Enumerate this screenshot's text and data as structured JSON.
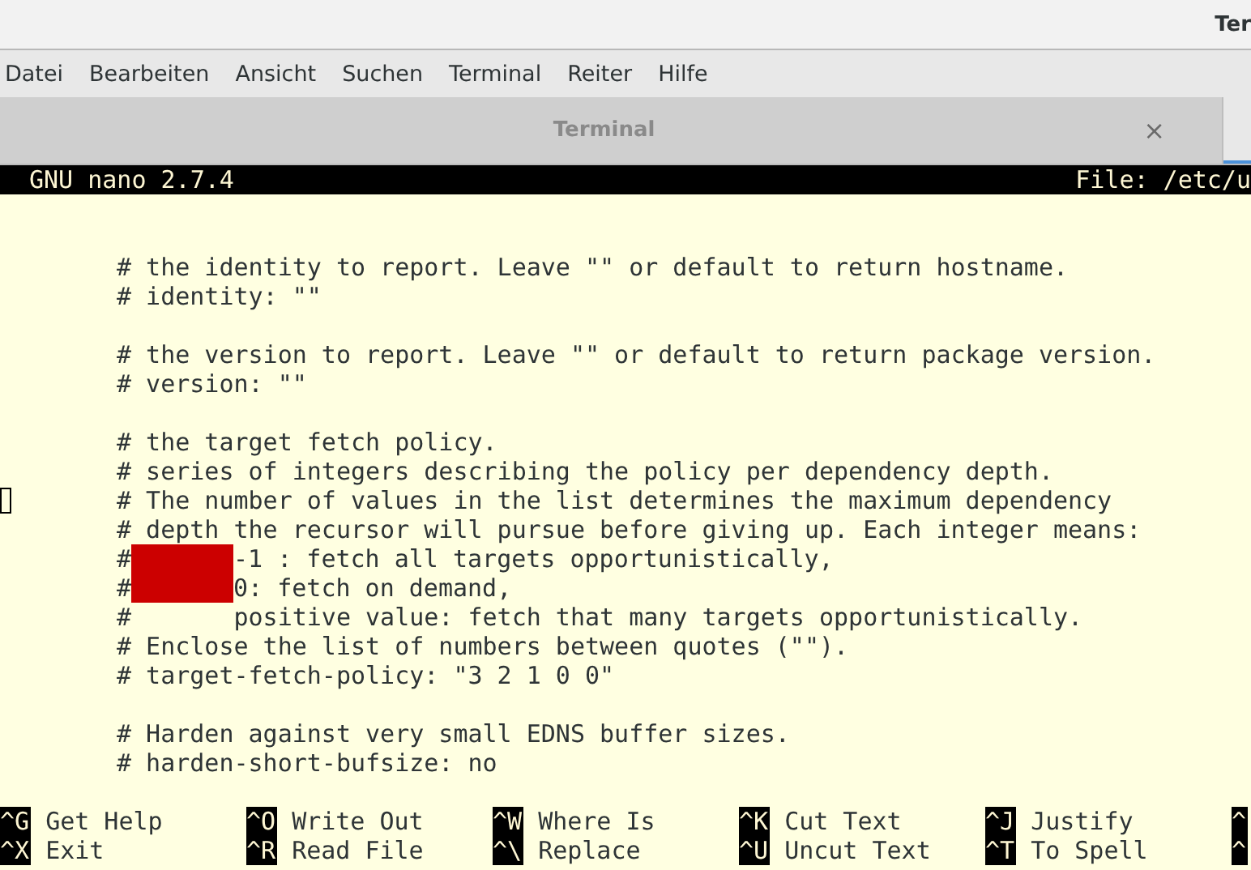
{
  "window": {
    "title": "Ter"
  },
  "menu": [
    "Datei",
    "Bearbeiten",
    "Ansicht",
    "Suchen",
    "Terminal",
    "Reiter",
    "Hilfe"
  ],
  "tabs": [
    {
      "label": "Terminal",
      "close": "×",
      "selected": false
    }
  ],
  "nano": {
    "version": "GNU nano 2.7.4",
    "file": "File: /etc/u",
    "lines": [
      {
        "kind": "blank"
      },
      {
        "kind": "blank"
      },
      {
        "kind": "text",
        "text": "# the identity to report. Leave \"\" or default to return hostname.",
        "cursor": false
      },
      {
        "kind": "text",
        "text": "# identity: \"\"",
        "cursor": false
      },
      {
        "kind": "blank"
      },
      {
        "kind": "text",
        "text": "# the version to report. Leave \"\" or default to return package version.",
        "cursor": false
      },
      {
        "kind": "text",
        "text": "# version: \"\"",
        "cursor": false
      },
      {
        "kind": "blank"
      },
      {
        "kind": "text",
        "text": "# the target fetch policy.",
        "cursor": false
      },
      {
        "kind": "text",
        "text": "# series of integers describing the policy per dependency depth.",
        "cursor": false
      },
      {
        "kind": "text",
        "text": "# The number of values in the list determines the maximum dependency",
        "cursor": true
      },
      {
        "kind": "text",
        "text": "# depth the recursor will pursue before giving up. Each integer means:",
        "cursor": false
      },
      {
        "kind": "tab",
        "prefix": "#",
        "text": "-1 : fetch all targets opportunistically,",
        "cursor": false
      },
      {
        "kind": "tab",
        "prefix": "#",
        "text": "0: fetch on demand,",
        "cursor": false
      },
      {
        "kind": "text",
        "text": "#       positive value: fetch that many targets opportunistically.",
        "cursor": false
      },
      {
        "kind": "text",
        "text": "# Enclose the list of numbers between quotes (\"\").",
        "cursor": false
      },
      {
        "kind": "text",
        "text": "# target-fetch-policy: \"3 2 1 0 0\"",
        "cursor": false
      },
      {
        "kind": "blank"
      },
      {
        "kind": "text",
        "text": "# Harden against very small EDNS buffer sizes.",
        "cursor": false
      },
      {
        "kind": "text",
        "text": "# harden-short-bufsize: no",
        "cursor": false
      }
    ],
    "shortcut_rows": [
      [
        {
          "key": "^G",
          "label": "Get Help"
        },
        {
          "key": "^O",
          "label": "Write Out"
        },
        {
          "key": "^W",
          "label": "Where Is"
        },
        {
          "key": "^K",
          "label": "Cut Text"
        },
        {
          "key": "^J",
          "label": "Justify"
        },
        {
          "key": "^"
        }
      ],
      [
        {
          "key": "^X",
          "label": "Exit"
        },
        {
          "key": "^R",
          "label": "Read File"
        },
        {
          "key": "^\\",
          "label": "Replace"
        },
        {
          "key": "^U",
          "label": "Uncut Text"
        },
        {
          "key": "^T",
          "label": "To Spell"
        },
        {
          "key": "^"
        }
      ]
    ]
  }
}
